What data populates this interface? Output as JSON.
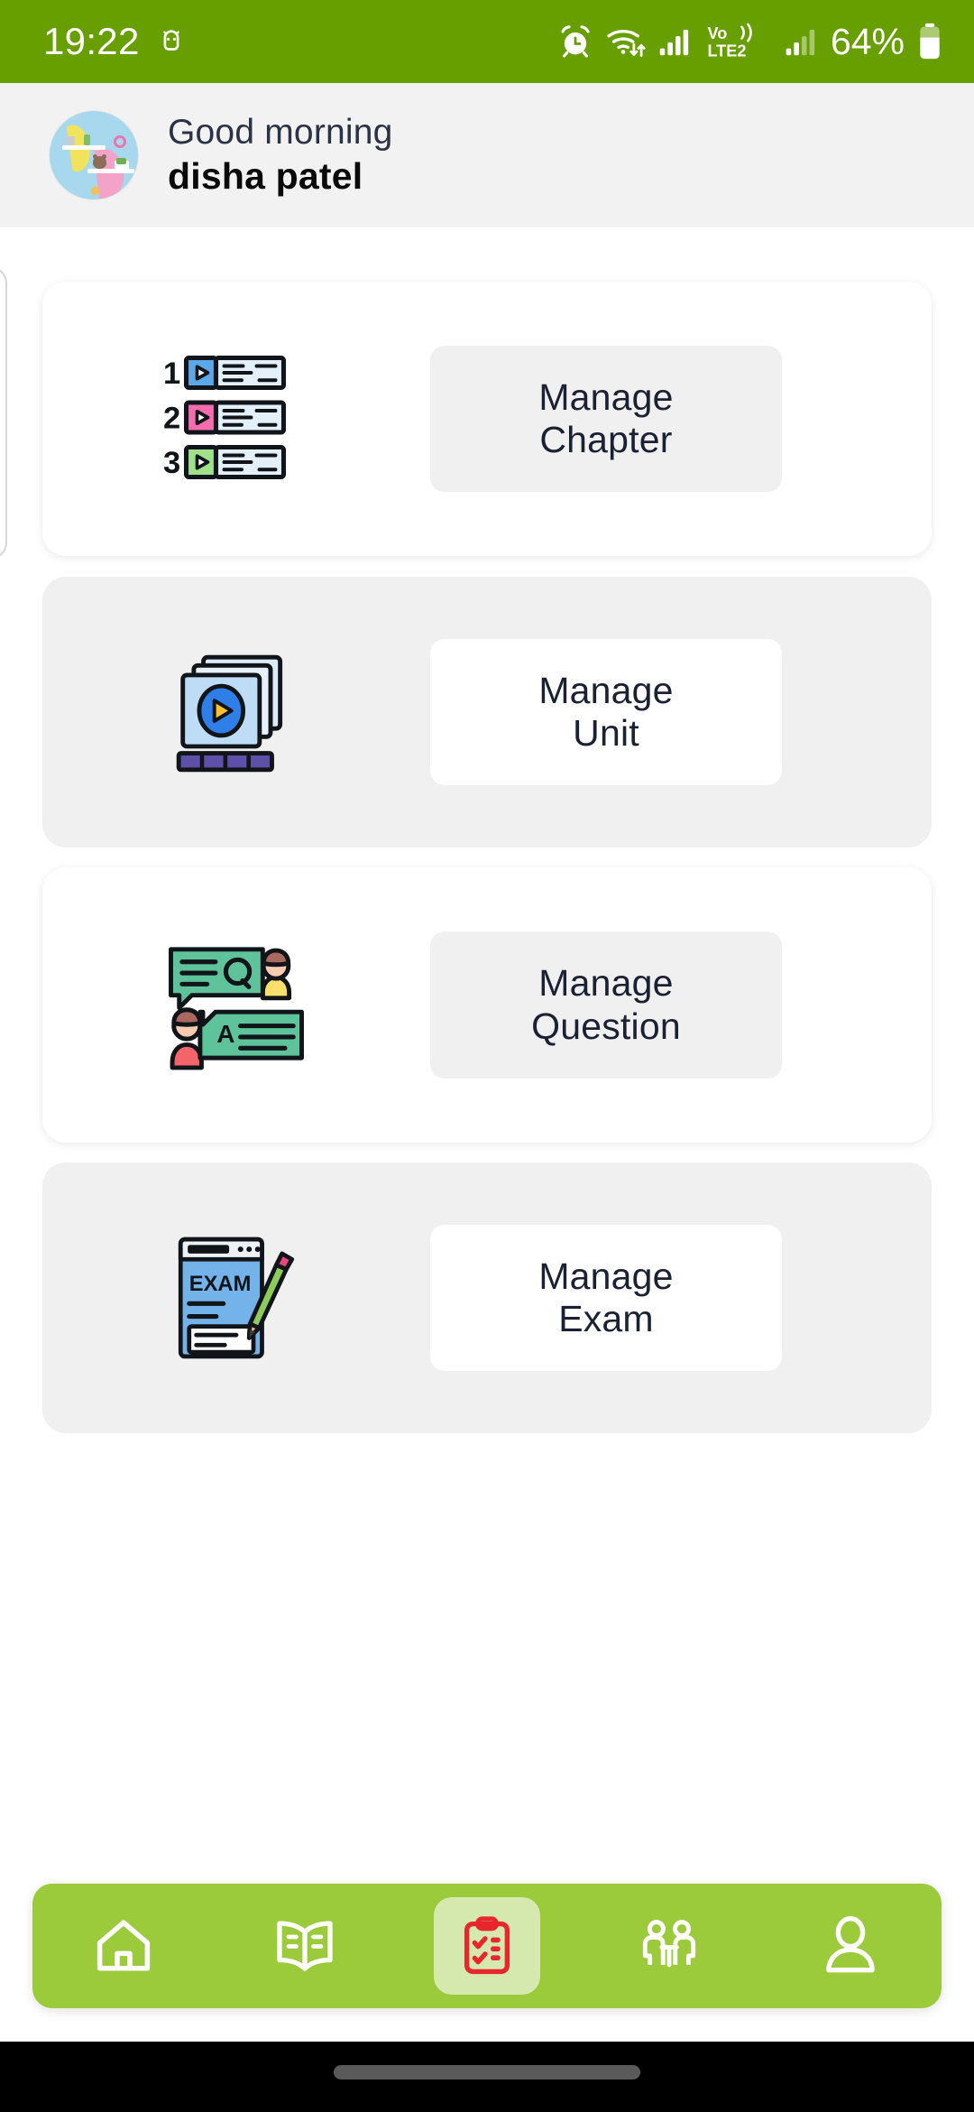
{
  "status_bar": {
    "time": "19:22",
    "battery_text": "64%",
    "network_label": "VoLTE2",
    "icons": [
      "android-head-icon",
      "alarm-icon",
      "wifi-icon",
      "signal-icon",
      "volte-icon",
      "signal-secondary-icon",
      "battery-icon"
    ],
    "background_color": "#679F00",
    "foreground_color": "#FFFFFF"
  },
  "header": {
    "greeting": "Good morning",
    "user_name": "disha patel",
    "avatar_name": "user-avatar",
    "background_color": "#F2F2F2"
  },
  "cards": [
    {
      "id": "manage-chapter",
      "icon": "chapter-playlist-icon",
      "label_line1": "Manage",
      "label_line2": "Chapter",
      "style": "light",
      "button_background": "#F0F0F0"
    },
    {
      "id": "manage-unit",
      "icon": "video-slides-icon",
      "label_line1": "Manage",
      "label_line2": "Unit",
      "style": "shade",
      "button_background": "#FFFFFF"
    },
    {
      "id": "manage-question",
      "icon": "question-answer-icon",
      "label_line1": "Manage",
      "label_line2": "Question",
      "style": "light",
      "button_background": "#F0F0F0"
    },
    {
      "id": "manage-exam",
      "icon": "exam-paper-pencil-icon",
      "label_line1": "Manage",
      "label_line2": "Exam",
      "style": "shade",
      "button_background": "#FFFFFF"
    }
  ],
  "bottom_nav": {
    "background_color": "#9BCB3B",
    "active_highlight_color": "#D5E8AE",
    "active_icon_color": "#E8262D",
    "items": [
      {
        "id": "nav-home",
        "icon": "home-icon",
        "active": false
      },
      {
        "id": "nav-book",
        "icon": "open-book-icon",
        "active": false
      },
      {
        "id": "nav-exam",
        "icon": "clipboard-checklist-icon",
        "active": true
      },
      {
        "id": "nav-interview",
        "icon": "two-people-table-icon",
        "active": false
      },
      {
        "id": "nav-profile",
        "icon": "person-icon",
        "active": false
      }
    ]
  },
  "gesture_bar": {
    "handle": "home-gesture-pill"
  },
  "chapter_icon_numbers": [
    "1",
    "2",
    "3"
  ],
  "chapter_icon_colors": [
    "#5BA7E8",
    "#F36CAE",
    "#9FE08B"
  ],
  "exam_icon_text": "EXAM"
}
